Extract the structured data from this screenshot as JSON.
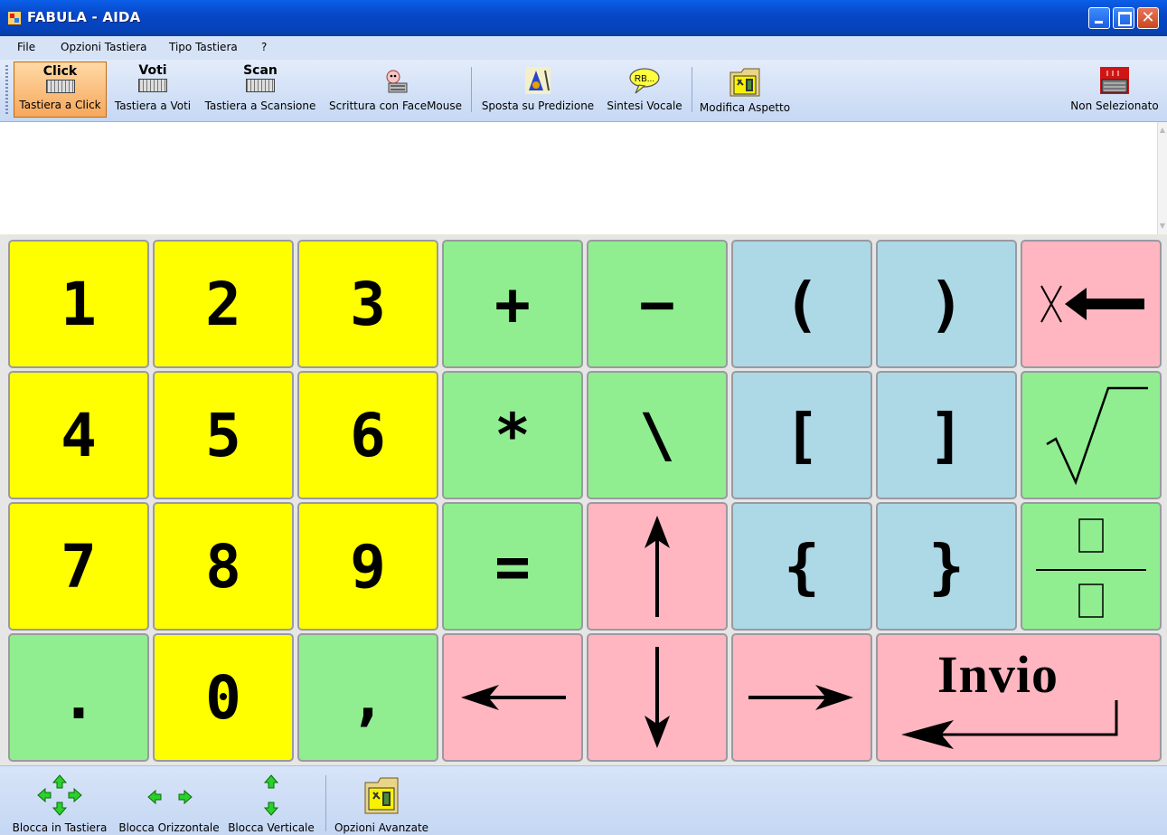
{
  "window": {
    "title": "FABULA - AIDA"
  },
  "menu": [
    "File",
    "Opzioni Tastiera",
    "Tipo Tastiera",
    "?"
  ],
  "toolbar": {
    "click": {
      "head": "Click",
      "label": "Tastiera a Click"
    },
    "voti": {
      "head": "Voti",
      "label": "Tastiera a Voti"
    },
    "scan": {
      "head": "Scan",
      "label": "Tastiera a Scansione"
    },
    "facemouse": {
      "label": "Scrittura con FaceMouse"
    },
    "prediction": {
      "label": "Sposta su Predizione"
    },
    "speech": {
      "label": "Sintesi Vocale",
      "icon_text": "RB..."
    },
    "appearance": {
      "label": "Modifica Aspetto"
    },
    "status": {
      "label": "Non Selezionato"
    }
  },
  "keyboard": {
    "colors": {
      "yellow": "#ffff00",
      "green": "#90ee90",
      "blue": "#add8e6",
      "pink": "#ffb6c1"
    },
    "keys": {
      "k1": "1",
      "k2": "2",
      "k3": "3",
      "plus": "+",
      "minus": "−",
      "lparen": "(",
      "rparen": ")",
      "k4": "4",
      "k5": "5",
      "k6": "6",
      "star": "*",
      "backslash": "\\",
      "lbracket": "[",
      "rbracket": "]",
      "k7": "7",
      "k8": "8",
      "k9": "9",
      "equals": "=",
      "lbrace": "{",
      "rbrace": "}",
      "dot": ".",
      "k0": "0",
      "comma": ",",
      "enter": "Invio"
    },
    "icons": {
      "backspace": "backspace-x-arrow-icon",
      "sqrt": "square-root-icon",
      "fraction": "fraction-icon",
      "up": "arrow-up-icon",
      "down": "arrow-down-icon",
      "left": "arrow-left-icon",
      "right": "arrow-right-icon",
      "enter": "enter-return-arrow-icon"
    }
  },
  "bottom": {
    "lock_keyboard": "Blocca in Tastiera",
    "lock_horizontal": "Blocca Orizzontale",
    "lock_vertical": "Blocca Verticale",
    "advanced": "Opzioni Avanzate"
  }
}
